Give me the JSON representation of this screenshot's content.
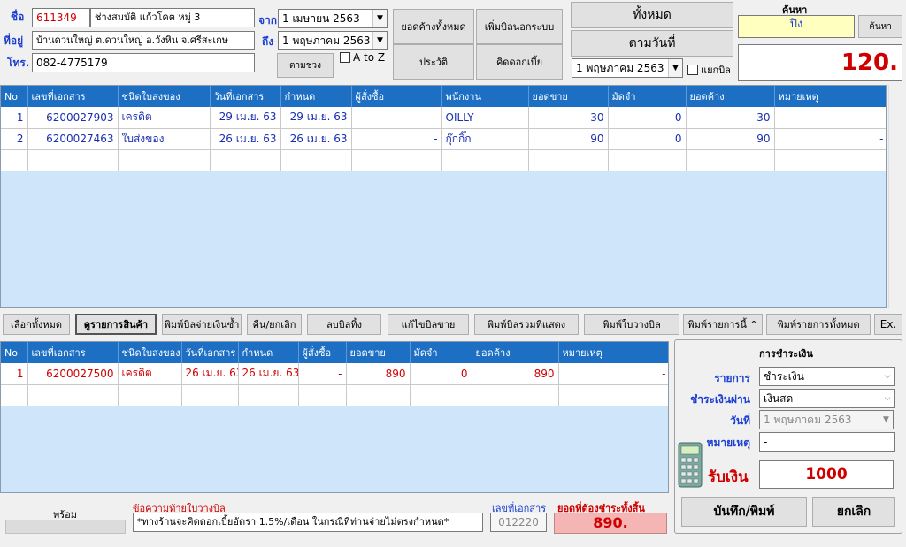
{
  "customer": {
    "name_label": "ชื่อ",
    "code": "611349",
    "name": "ช่างสมบัติ แก้วโคต หมู่ 3",
    "address_label": "ที่อยู่",
    "address": "บ้านดวนใหญ่ ต.ดวนใหญ่ อ.วังหิน จ.ศรีสะเกษ",
    "phone_label": "โทร.",
    "phone": "082-4775179"
  },
  "date_range": {
    "from_label": "จาก",
    "from_value": "1  เมษายน    2563",
    "to_label": "ถึง",
    "to_value": "1  พฤษภาคม  2563",
    "range_button": "ตามช่วง",
    "atoz_label": "A to Z",
    "atoz_checked": false
  },
  "actions": {
    "all_outstanding": "ยอดค้างทั้งหมด",
    "add_outside_bill": "เพิ่มบิลนอกระบบ",
    "history": "ประวัติ",
    "calc_interest": "คิดดอกเบี้ย"
  },
  "view": {
    "all_button": "ทั้งหมด",
    "by_date_button": "ตามวันที่",
    "date_value": "1  พฤษภาคม  2563",
    "split_bill_label": "แยกบิล",
    "split_bill_checked": false
  },
  "search": {
    "label": "ค้นหา",
    "value": "ปิง",
    "button": "ค้นหา",
    "total": "120."
  },
  "top_table": {
    "columns": [
      "No",
      "เลขที่เอกสาร",
      "ชนิดใบส่งของ",
      "วันที่เอกสาร",
      "กำหนด",
      "ผู้สั่งซื้อ",
      "พนักงาน",
      "ยอดขาย",
      "มัดจำ",
      "ยอดค้าง",
      "หมายเหตุ"
    ],
    "rows": [
      {
        "no": "1",
        "doc": "6200027903",
        "type": "เครดิต",
        "date": "29 เม.ย. 63",
        "due": "29 เม.ย. 63",
        "buyer": "-",
        "staff": "OILLY",
        "sales": "30",
        "deposit": "0",
        "balance": "30",
        "note": "-"
      },
      {
        "no": "2",
        "doc": "6200027463",
        "type": "ใบส่งของ",
        "date": "26 เม.ย. 63",
        "due": "26 เม.ย. 63",
        "buyer": "-",
        "staff": "กุ๊กกิ๊ก",
        "sales": "90",
        "deposit": "0",
        "balance": "90",
        "note": "-"
      }
    ]
  },
  "toolbar": {
    "select_all": "เลือกทั้งหมด",
    "view_items": "ดูรายการสินค้า",
    "print_duplicate": "พิมพ์บิลจ่ายเงินซ้ำ",
    "return_cancel": "คืน/ยกเลิก",
    "delete_bill": "ลบบิลทิ้ง",
    "edit_sale": "แก้ไขบิลขาย",
    "print_combined": "พิมพ์บิลรวมที่แสดง",
    "print_invoice": "พิมพ์ใบวางบิล",
    "print_this": "พิมพ์รายการนี้ ^",
    "print_all": "พิมพ์รายการทั้งหมด",
    "exit": "Ex."
  },
  "bottom_table": {
    "columns": [
      "No",
      "เลขที่เอกสาร",
      "ชนิดใบส่งของ",
      "วันที่เอกสาร",
      "กำหนด",
      "ผู้สั่งซื้อ",
      "ยอดขาย",
      "มัดจำ",
      "ยอดค้าง",
      "หมายเหตุ"
    ],
    "rows": [
      {
        "no": "1",
        "doc": "6200027500",
        "type": "เครดิต",
        "date": "26 เม.ย. 63",
        "due": "26 เม.ย. 63",
        "buyer": "-",
        "sales": "890",
        "deposit": "0",
        "balance": "890",
        "note": "-"
      }
    ]
  },
  "payment": {
    "title": "การชำระเงิน",
    "item_label": "รายการ",
    "item_value": "ชำระเงิน",
    "method_label": "ชำระเงินผ่าน",
    "method_value": "เงินสด",
    "date_label": "วันที่",
    "date_value": "1  พฤษภาคม  2563",
    "note_label": "หมายเหตุ",
    "note_value": "-",
    "receive_label": "รับเงิน",
    "receive_value": "1000",
    "save_print": "บันทึก/พิมพ์",
    "cancel": "ยกเลิก"
  },
  "footer": {
    "status": "พร้อม",
    "message_label": "ข้อความท้ายใบวางบิล",
    "message": "*ทางร้านจะคิดดอกเบี้ยอัตรา 1.5%/เดือน ในกรณีที่ท่านจ่ายไม่ตรงกำหนด*",
    "doc_label": "เลขที่เอกสาร",
    "doc_value": "012220",
    "total_label": "ยอดที่ต้องชำระทั้งสิ้น",
    "total_value": "890."
  },
  "colors": {
    "accent": "#1d6fc4",
    "grid_bg": "#cfe6fa",
    "search_bg": "#ffffc0",
    "total_bg": "#f5b5b5",
    "red": "#d00000",
    "label_blue": "#1a3fd0"
  }
}
